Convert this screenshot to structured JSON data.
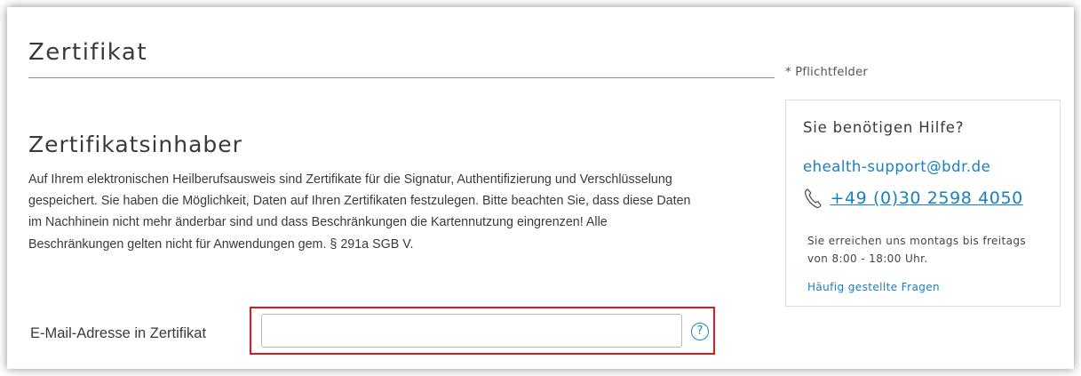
{
  "page": {
    "title": "Zertifikat",
    "required_note": "* Pflichtfelder"
  },
  "section": {
    "title": "Zertifikatsinhaber",
    "intro_text": "Auf Ihrem elektronischen Heilberufsausweis sind Zertifikate für die Signatur, Authentifizierung und Verschlüsselung gespeichert. Sie haben die Möglichkeit, Daten auf Ihren Zertifikaten festzulegen. Bitte beachten Sie, dass diese Daten im Nachhinein nicht mehr änderbar sind und dass Beschränkungen die Kartennutzung eingrenzen! Alle Beschränkungen gelten nicht für Anwendungen gem. § 291a SGB V."
  },
  "form": {
    "email_label": "E-Mail-Adresse in Zertifikat",
    "email_value": "",
    "help_icon": "question-circle-icon",
    "help_icon_glyph": "?",
    "highlight_color": "#e0191f"
  },
  "help_panel": {
    "title": "Sie benötigen Hilfe?",
    "email": "ehealth-support@bdr.de",
    "phone_icon": "phone-icon",
    "phone": "+49 (0)30 2598 4050",
    "hours": "Sie erreichen uns montags bis freitags von 8:00 - 18:00 Uhr.",
    "faq_link": "Häufig gestellte Fragen"
  },
  "colors": {
    "link": "#1a7fbf",
    "text": "#3a3a3a",
    "highlight": "#e0191f"
  }
}
